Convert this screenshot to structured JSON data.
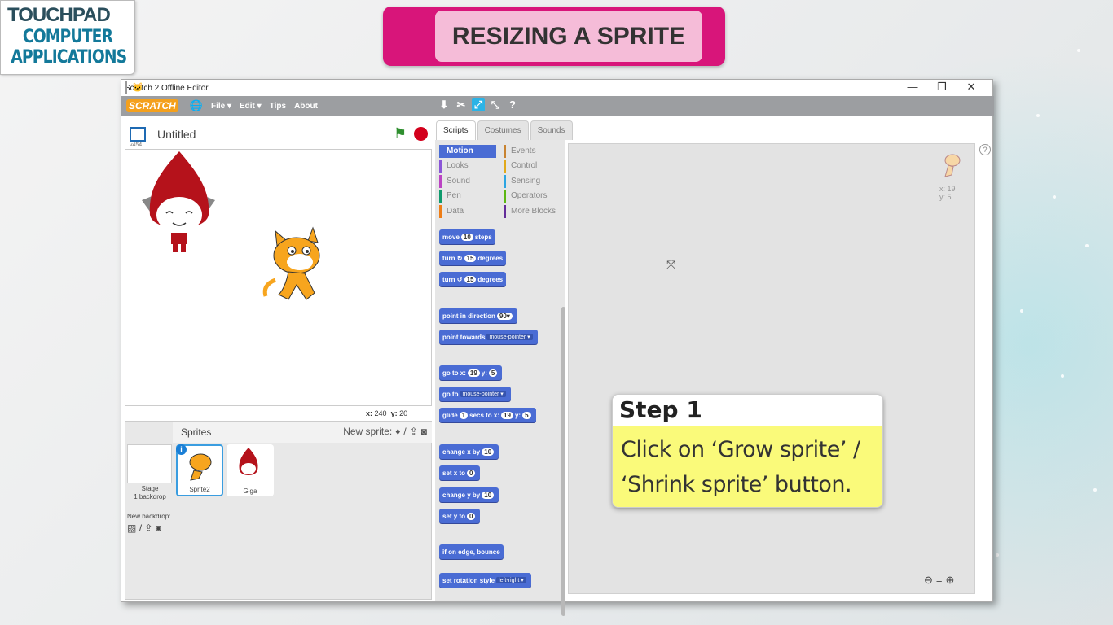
{
  "logo": {
    "line1": "TOUCHPAD",
    "line2": "COMPUTER",
    "line3": "APPLICATIONS"
  },
  "banner": {
    "title": "RESIZING A SPRITE"
  },
  "window": {
    "title": "Scratch 2 Offline Editor",
    "minimize": "—",
    "restore": "❐",
    "close": "✕"
  },
  "menubar": {
    "logo": "SCRATCH",
    "items": [
      "File ▾",
      "Edit ▾",
      "Tips",
      "About"
    ],
    "tools": [
      "duplicate-icon",
      "delete-icon",
      "grow-icon",
      "shrink-icon",
      "help-icon"
    ]
  },
  "stage": {
    "title": "Untitled",
    "version": "v454",
    "coords": {
      "x_label": "x:",
      "x": "240",
      "y_label": "y:",
      "y": "20"
    }
  },
  "sprites": {
    "header": "Sprites",
    "new_sprite_label": "New sprite:",
    "stage_label": "Stage",
    "stage_sub": "1 backdrop",
    "new_backdrop_label": "New backdrop:",
    "items": [
      {
        "name": "Sprite2",
        "selected": true
      },
      {
        "name": "Giga",
        "selected": false
      }
    ]
  },
  "tabs": [
    "Scripts",
    "Costumes",
    "Sounds"
  ],
  "categories": {
    "left": [
      "Motion",
      "Looks",
      "Sound",
      "Pen",
      "Data"
    ],
    "right": [
      "Events",
      "Control",
      "Sensing",
      "Operators",
      "More Blocks"
    ],
    "colors": {
      "Motion": "#4a6cd4",
      "Looks": "#8a55d7",
      "Sound": "#bb42c3",
      "Pen": "#0e9a6c",
      "Data": "#ee7d16",
      "Events": "#c88330",
      "Control": "#e1a91a",
      "Sensing": "#2ca5e2",
      "Operators": "#5cb712",
      "More Blocks": "#632d99"
    }
  },
  "blocks": {
    "move": {
      "pre": "move",
      "val": "10",
      "post": "steps"
    },
    "turn_right": {
      "pre": "turn",
      "val": "15",
      "post": "degrees"
    },
    "turn_left": {
      "pre": "turn",
      "val": "15",
      "post": "degrees"
    },
    "point_dir": {
      "pre": "point in direction",
      "val": "90▾"
    },
    "point_towards": {
      "pre": "point towards",
      "val": "mouse-pointer ▾"
    },
    "goto_xy": {
      "pre": "go to x:",
      "x": "19",
      "mid": "y:",
      "y": "5"
    },
    "goto": {
      "pre": "go to",
      "val": "mouse-pointer ▾"
    },
    "glide": {
      "pre": "glide",
      "secs": "1",
      "mid1": "secs to x:",
      "x": "19",
      "mid2": "y:",
      "y": "5"
    },
    "change_x": {
      "pre": "change x by",
      "val": "10"
    },
    "set_x": {
      "pre": "set x to",
      "val": "0"
    },
    "change_y": {
      "pre": "change y by",
      "val": "10"
    },
    "set_y": {
      "pre": "set y to",
      "val": "0"
    },
    "bounce": {
      "pre": "if on edge, bounce"
    },
    "rotation": {
      "pre": "set rotation style",
      "val": "left-right ▾"
    }
  },
  "script_area": {
    "sprite_x": "x: 19",
    "sprite_y": "y: 5"
  },
  "step": {
    "title": "Step 1",
    "line1": "Click on ‘Grow sprite’ /",
    "line2": "‘Shrink sprite’ button."
  }
}
